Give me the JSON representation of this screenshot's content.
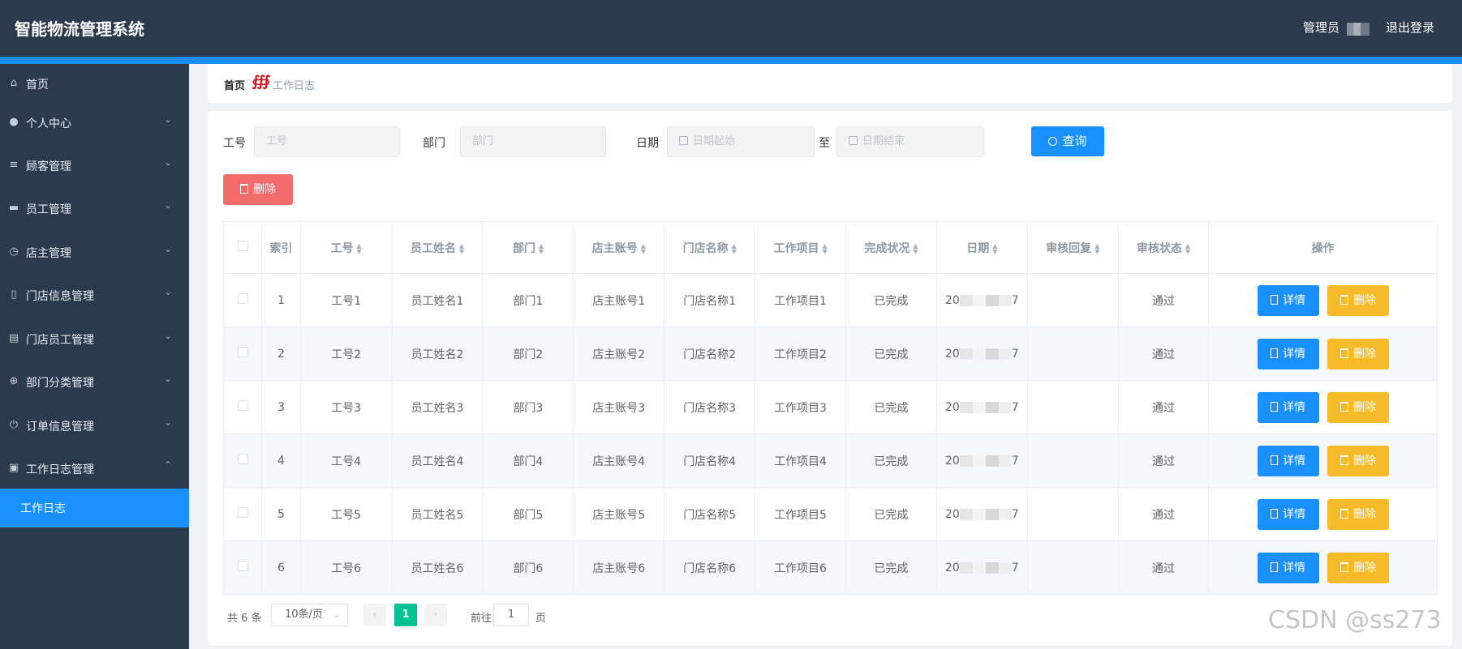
{
  "app": {
    "title": "智能物流管理系统",
    "user_label": "管理员",
    "logout_label": "退出登录"
  },
  "sidebar": {
    "items": [
      {
        "label": "首页",
        "icon": "home-icon",
        "arrow": ""
      },
      {
        "label": "个人中心",
        "icon": "user-icon",
        "arrow": "⌄"
      },
      {
        "label": "顾客管理",
        "icon": "menu-icon",
        "arrow": "⌄"
      },
      {
        "label": "员工管理",
        "icon": "briefcase-icon",
        "arrow": "⌄"
      },
      {
        "label": "店主管理",
        "icon": "clock-icon",
        "arrow": "⌄"
      },
      {
        "label": "门店信息管理",
        "icon": "mobile-icon",
        "arrow": "⌄"
      },
      {
        "label": "门店员工管理",
        "icon": "clipboard-icon",
        "arrow": "⌄"
      },
      {
        "label": "部门分类管理",
        "icon": "aim-icon",
        "arrow": "⌄"
      },
      {
        "label": "订单信息管理",
        "icon": "power-icon",
        "arrow": "⌄"
      },
      {
        "label": "工作日志管理",
        "icon": "checklist-icon",
        "arrow": "⌃"
      }
    ],
    "active_sub": "工作日志"
  },
  "breadcrumb": {
    "home": "首页",
    "separator": "∰",
    "current": "工作日志"
  },
  "filters": {
    "emp_no_label": "工号",
    "emp_no_placeholder": "工号",
    "dept_label": "部门",
    "dept_placeholder": "部门",
    "date_label": "日期",
    "date_start_placeholder": "日期起始",
    "to_label": "至",
    "date_end_placeholder": "日期结束",
    "query_label": "查询"
  },
  "delete_label": "删除",
  "table": {
    "headers": [
      "索引",
      "工号",
      "员工姓名",
      "部门",
      "店主账号",
      "门店名称",
      "工作项目",
      "完成状况",
      "日期",
      "审核回复",
      "审核状态",
      "操作"
    ],
    "rows": [
      {
        "index": "1",
        "emp_no": "工号1",
        "name": "员工姓名1",
        "dept": "部门1",
        "owner": "店主账号1",
        "store": "门店名称1",
        "project": "工作项目1",
        "status": "已完成",
        "date_a": "20",
        "date_b": "7",
        "reply": "",
        "audit": "通过"
      },
      {
        "index": "2",
        "emp_no": "工号2",
        "name": "员工姓名2",
        "dept": "部门2",
        "owner": "店主账号2",
        "store": "门店名称2",
        "project": "工作项目2",
        "status": "已完成",
        "date_a": "20",
        "date_b": "7",
        "reply": "",
        "audit": "通过"
      },
      {
        "index": "3",
        "emp_no": "工号3",
        "name": "员工姓名3",
        "dept": "部门3",
        "owner": "店主账号3",
        "store": "门店名称3",
        "project": "工作项目3",
        "status": "已完成",
        "date_a": "20",
        "date_b": "7",
        "reply": "",
        "audit": "通过"
      },
      {
        "index": "4",
        "emp_no": "工号4",
        "name": "员工姓名4",
        "dept": "部门4",
        "owner": "店主账号4",
        "store": "门店名称4",
        "project": "工作项目4",
        "status": "已完成",
        "date_a": "20",
        "date_b": "7",
        "reply": "",
        "audit": "通过"
      },
      {
        "index": "5",
        "emp_no": "工号5",
        "name": "员工姓名5",
        "dept": "部门5",
        "owner": "店主账号5",
        "store": "门店名称5",
        "project": "工作项目5",
        "status": "已完成",
        "date_a": "20",
        "date_b": "7",
        "reply": "",
        "audit": "通过"
      },
      {
        "index": "6",
        "emp_no": "工号6",
        "name": "员工姓名6",
        "dept": "部门6",
        "owner": "店主账号6",
        "store": "门店名称6",
        "project": "工作项目6",
        "status": "已完成",
        "date_a": "20",
        "date_b": "7",
        "reply": "",
        "audit": "通过"
      }
    ],
    "detail_label": "详情",
    "row_delete_label": "删除"
  },
  "pagination": {
    "total": "共 6 条",
    "page_size": "10条/页",
    "current_page": "1",
    "goto_label": "前往",
    "goto_value": "1",
    "goto_suffix": "页"
  },
  "watermark": "CSDN @ss273",
  "colors": {
    "header_bg": "#2c3a4e",
    "accent": "#1890ff",
    "danger": "#f56c6c",
    "warning": "#f7bb2a",
    "page_active": "#00c292"
  }
}
